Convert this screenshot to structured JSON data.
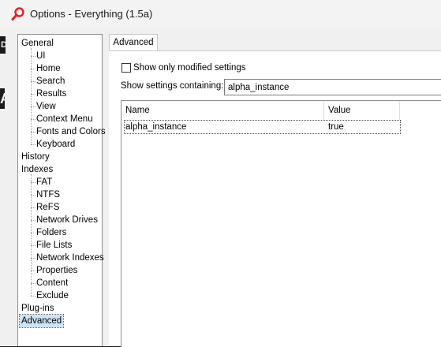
{
  "window": {
    "title": "Options - Everything (1.5a)"
  },
  "background": {
    "left_letter_top": "D",
    "left_letter_mid": "A"
  },
  "tree": {
    "items": [
      {
        "label": "General",
        "level": 0
      },
      {
        "label": "UI",
        "level": 1
      },
      {
        "label": "Home",
        "level": 1
      },
      {
        "label": "Search",
        "level": 1
      },
      {
        "label": "Results",
        "level": 1
      },
      {
        "label": "View",
        "level": 1
      },
      {
        "label": "Context Menu",
        "level": 1
      },
      {
        "label": "Fonts and Colors",
        "level": 1
      },
      {
        "label": "Keyboard",
        "level": 1
      },
      {
        "label": "History",
        "level": 0
      },
      {
        "label": "Indexes",
        "level": 0
      },
      {
        "label": "FAT",
        "level": 1
      },
      {
        "label": "NTFS",
        "level": 1
      },
      {
        "label": "ReFS",
        "level": 1
      },
      {
        "label": "Network Drives",
        "level": 1
      },
      {
        "label": "Folders",
        "level": 1
      },
      {
        "label": "File Lists",
        "level": 1
      },
      {
        "label": "Network Indexes",
        "level": 1
      },
      {
        "label": "Properties",
        "level": 1
      },
      {
        "label": "Content",
        "level": 1
      },
      {
        "label": "Exclude",
        "level": 1
      },
      {
        "label": "Plug-ins",
        "level": 0
      },
      {
        "label": "Advanced",
        "level": 0,
        "selected": true
      }
    ]
  },
  "tab": {
    "label": "Advanced"
  },
  "settings": {
    "show_only_modified_label": "Show only modified settings",
    "show_only_modified_checked": false,
    "filter_label": "Show settings containing:",
    "filter_value": "alpha_instance"
  },
  "list": {
    "columns": {
      "name": "Name",
      "value": "Value"
    },
    "rows": [
      {
        "name": "alpha_instance",
        "value": "true"
      }
    ]
  },
  "colors": {
    "selection": "#cce4f7",
    "icon_red": "#e02020"
  }
}
